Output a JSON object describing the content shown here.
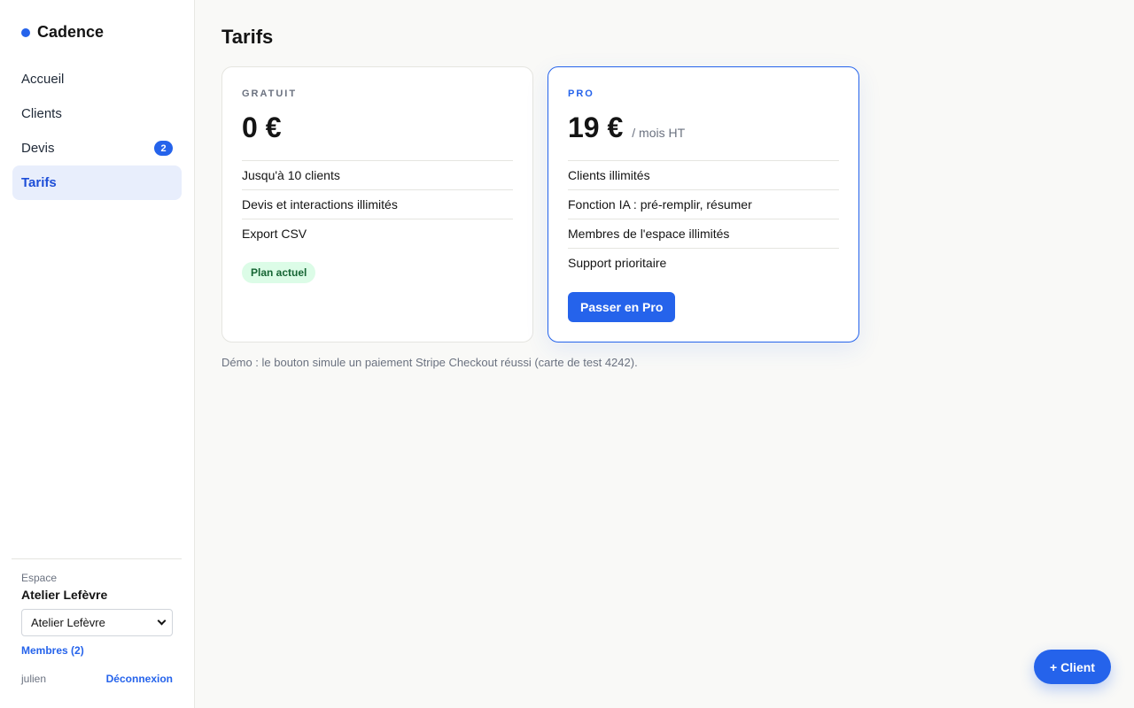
{
  "app": {
    "name": "Cadence",
    "accent_color": "#2563eb"
  },
  "sidebar": {
    "items": [
      {
        "label": "Accueil"
      },
      {
        "label": "Clients"
      },
      {
        "label": "Devis",
        "badge": "2"
      },
      {
        "label": "Tarifs",
        "active": true
      }
    ],
    "footer": {
      "workspace_label": "Espace",
      "workspace_name": "Atelier Lefèvre",
      "workspace_select_value": "Atelier Lefèvre",
      "members_link": "Membres (2)",
      "user_name": "julien",
      "logout_label": "Déconnexion"
    }
  },
  "main": {
    "title": "Tarifs",
    "plans": [
      {
        "tier": "GRATUIT",
        "price": "0 €",
        "period": "",
        "features": [
          "Jusqu'à 10 clients",
          "Devis et interactions illimités",
          "Export CSV"
        ],
        "status_badge": "Plan actuel"
      },
      {
        "tier": "PRO",
        "price": "19 €",
        "period": "/ mois HT",
        "features": [
          "Clients illimités",
          "Fonction IA : pré-remplir, résumer",
          "Membres de l'espace illimités",
          "Support prioritaire"
        ],
        "cta_label": "Passer en Pro"
      }
    ],
    "demo_note": "Démo : le bouton simule un paiement Stripe Checkout réussi (carte de test 4242)."
  },
  "fab": {
    "label": "+ Client"
  }
}
